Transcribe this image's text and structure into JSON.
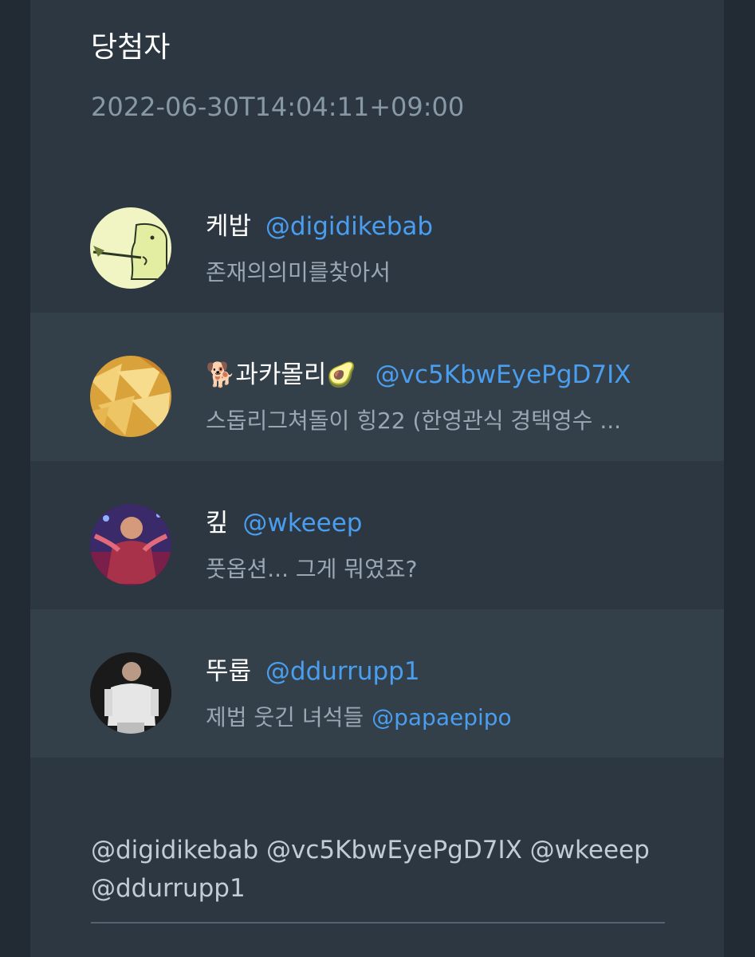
{
  "title": "당첨자",
  "timestamp": "2022-06-30T14:04:11+09:00",
  "winners": [
    {
      "name": "케밥",
      "handle": "@digidikebab",
      "bio": "존재의의미를찾아서",
      "avatar": "cartoon-figure-avatar"
    },
    {
      "name_prefix_emoji": "🐕",
      "name": "과카몰리",
      "name_suffix_emoji": "🥑",
      "handle": "@vc5KbwEyePgD7IX",
      "bio": "스돕리그쳐돌이 힝22 (한영관식 경택영수 ...",
      "avatar": "nachos-avatar"
    },
    {
      "name": "킾",
      "handle": "@wkeeep",
      "bio": "풋옵션... 그게 뭐였죠?",
      "avatar": "performer-avatar"
    },
    {
      "name": "뚜룹",
      "handle": "@ddurrupp1",
      "bio": "제법 웃긴 녀석들",
      "bio_mention": "@papaepipo",
      "avatar": "person-photo-avatar"
    }
  ],
  "mentions_line": "@digidikebab @vc5KbwEyePgD7IX @wkeeep @ddurrupp1"
}
